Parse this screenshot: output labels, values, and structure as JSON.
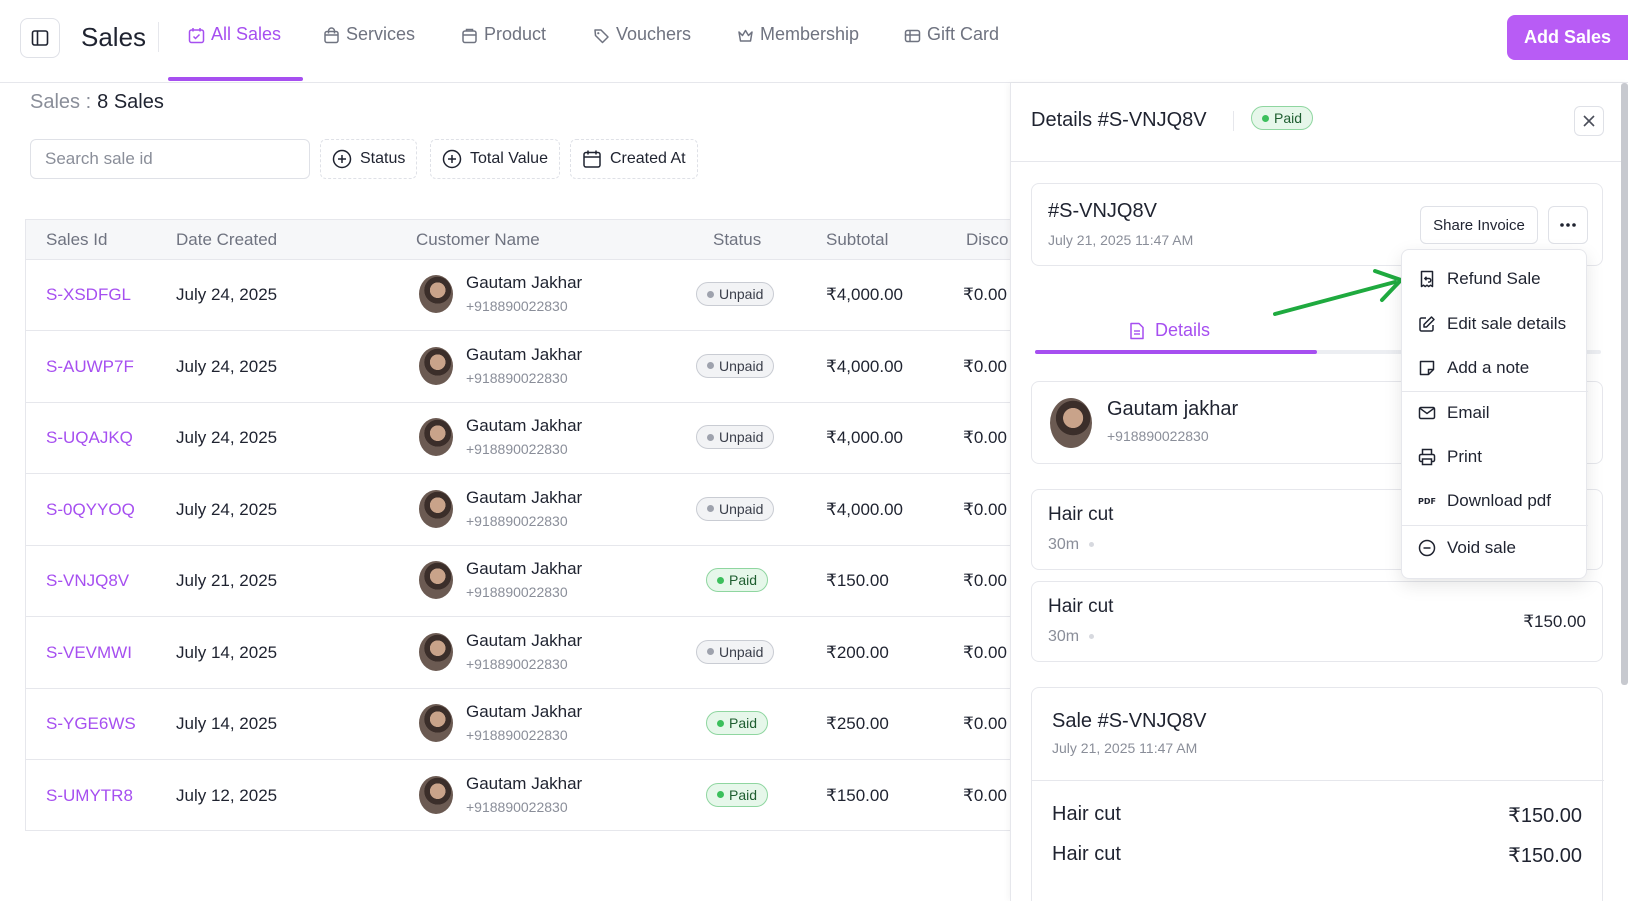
{
  "header": {
    "title": "Sales",
    "tabs": [
      {
        "label": "All Sales",
        "icon": "calendar-check-icon",
        "active": true
      },
      {
        "label": "Services",
        "icon": "bag-icon"
      },
      {
        "label": "Product",
        "icon": "box-icon"
      },
      {
        "label": "Vouchers",
        "icon": "tag-icon"
      },
      {
        "label": "Membership",
        "icon": "crown-icon"
      },
      {
        "label": "Gift Card",
        "icon": "gift-card-icon"
      }
    ],
    "add_button": "Add Sales",
    "accent_color": "#a64ff0"
  },
  "summary": {
    "label": "Sales :",
    "count": "8 Sales"
  },
  "search": {
    "placeholder": "Search sale id",
    "value": ""
  },
  "filters": [
    {
      "label": "Status",
      "icon": "plus-circle-icon"
    },
    {
      "label": "Total Value",
      "icon": "plus-circle-icon"
    },
    {
      "label": "Created At",
      "icon": "calendar-icon"
    }
  ],
  "table": {
    "columns": [
      "Sales Id",
      "Date Created",
      "Customer Name",
      "Status",
      "Subtotal",
      "Disco"
    ],
    "rows": [
      {
        "id": "S-XSDFGL",
        "date": "July 24, 2025",
        "name": "Gautam Jakhar",
        "phone": "+918890022830",
        "status": "Unpaid",
        "subtotal": "₹4,000.00",
        "discount": "₹0.00"
      },
      {
        "id": "S-AUWP7F",
        "date": "July 24, 2025",
        "name": "Gautam Jakhar",
        "phone": "+918890022830",
        "status": "Unpaid",
        "subtotal": "₹4,000.00",
        "discount": "₹0.00"
      },
      {
        "id": "S-UQAJKQ",
        "date": "July 24, 2025",
        "name": "Gautam Jakhar",
        "phone": "+918890022830",
        "status": "Unpaid",
        "subtotal": "₹4,000.00",
        "discount": "₹0.00"
      },
      {
        "id": "S-0QYYOQ",
        "date": "July 24, 2025",
        "name": "Gautam Jakhar",
        "phone": "+918890022830",
        "status": "Unpaid",
        "subtotal": "₹4,000.00",
        "discount": "₹0.00"
      },
      {
        "id": "S-VNJQ8V",
        "date": "July 21, 2025",
        "name": "Gautam Jakhar",
        "phone": "+918890022830",
        "status": "Paid",
        "subtotal": "₹150.00",
        "discount": "₹0.00"
      },
      {
        "id": "S-VEVMWI",
        "date": "July 14, 2025",
        "name": "Gautam Jakhar",
        "phone": "+918890022830",
        "status": "Unpaid",
        "subtotal": "₹200.00",
        "discount": "₹0.00"
      },
      {
        "id": "S-YGE6WS",
        "date": "July 14, 2025",
        "name": "Gautam Jakhar",
        "phone": "+918890022830",
        "status": "Paid",
        "subtotal": "₹250.00",
        "discount": "₹0.00"
      },
      {
        "id": "S-UMYTR8",
        "date": "July 12, 2025",
        "name": "Gautam Jakhar",
        "phone": "+918890022830",
        "status": "Paid",
        "subtotal": "₹150.00",
        "discount": "₹0.00"
      }
    ]
  },
  "details": {
    "title": "Details #S-VNJQ8V",
    "status": "Paid",
    "invoice_id": "#S-VNJQ8V",
    "invoice_date": "July 21, 2025 11:47 AM",
    "share_label": "Share Invoice",
    "tab_label": "Details",
    "customer": {
      "name": "Gautam jakhar",
      "phone": "+918890022830"
    },
    "services": [
      {
        "name": "Hair cut",
        "duration": "30m",
        "price": ""
      },
      {
        "name": "Hair cut",
        "duration": "30m",
        "price": "₹150.00"
      }
    ],
    "sale": {
      "title": "Sale #S-VNJQ8V",
      "date": "July 21, 2025 11:47 AM",
      "lines": [
        {
          "name": "Hair cut",
          "price": "₹150.00"
        },
        {
          "name": "Hair cut",
          "price": "₹150.00"
        }
      ]
    }
  },
  "menu": {
    "items": [
      {
        "label": "Refund Sale",
        "icon": "receipt-refund-icon"
      },
      {
        "label": "Edit sale details",
        "icon": "edit-icon"
      },
      {
        "label": "Add a note",
        "icon": "note-icon"
      },
      {
        "label": "Email",
        "icon": "mail-icon"
      },
      {
        "label": "Print",
        "icon": "printer-icon"
      },
      {
        "label": "Download pdf",
        "icon": "pdf-icon",
        "glyph": "PDF"
      },
      {
        "label": "Void sale",
        "icon": "minus-circle-icon"
      }
    ],
    "pointer_color": "#1faa3f"
  }
}
